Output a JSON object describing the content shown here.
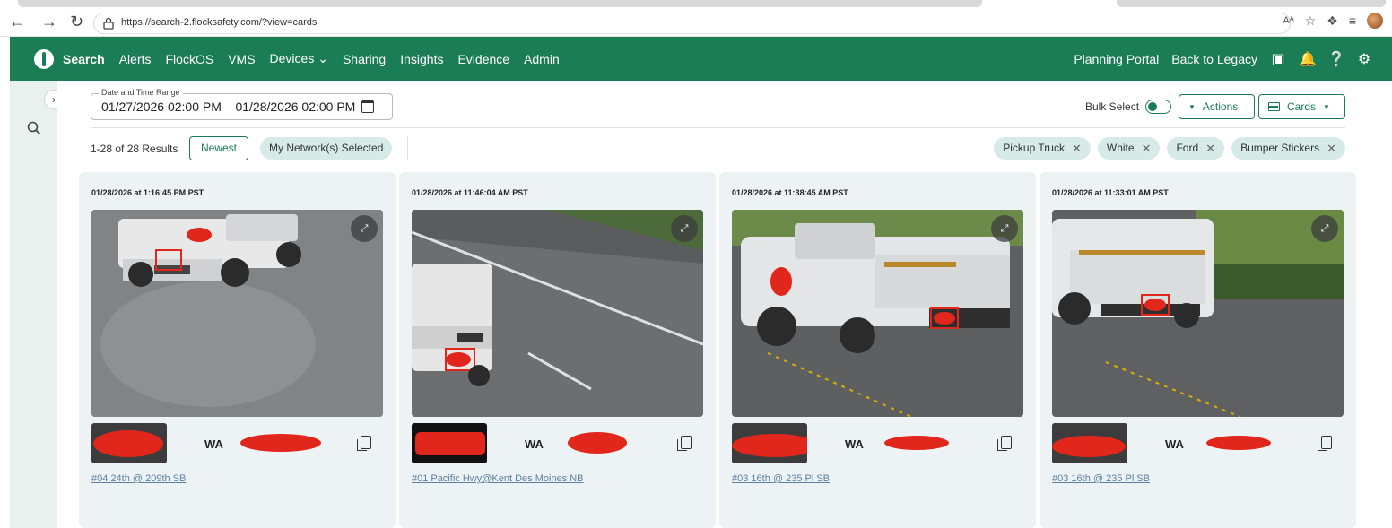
{
  "browser": {
    "url": "https://search-2.flocksafety.com/?view=cards",
    "back_icon": "back-arrow-icon",
    "forward_icon": "forward-arrow-icon",
    "reload_icon": "reload-icon",
    "read_aloud": "Aᴬ"
  },
  "nav": {
    "items": [
      {
        "label": "Search",
        "active": true
      },
      {
        "label": "Alerts"
      },
      {
        "label": "FlockOS"
      },
      {
        "label": "VMS"
      },
      {
        "label": "Devices ⌄"
      },
      {
        "label": "Sharing"
      },
      {
        "label": "Insights"
      },
      {
        "label": "Evidence"
      },
      {
        "label": "Admin"
      }
    ],
    "right_links": [
      "Planning Portal",
      "Back to Legacy"
    ],
    "right_icons": [
      "camera-icon",
      "bell-icon",
      "help-icon",
      "user-settings-icon"
    ]
  },
  "toolbar": {
    "date_label": "Date and Time Range",
    "date_value": "01/27/2026 02:00 PM – 01/28/2026 02:00 PM",
    "bulk_select": "Bulk Select",
    "actions": "Actions",
    "cards": "Cards"
  },
  "results": {
    "count": "1-28 of 28 Results",
    "sort": "Newest",
    "network": "My Network(s) Selected",
    "filters": [
      "Pickup Truck",
      "White",
      "Ford",
      "Bumper Stickers"
    ]
  },
  "cards": [
    {
      "time": "01/28/2026 at 1:16:45 PM PST",
      "state": "WA",
      "camera": "#04 24th @ 209th SB"
    },
    {
      "time": "01/28/2026 at 11:46:04 AM PST",
      "state": "WA",
      "camera": "#01 Pacific Hwy@Kent Des Moines NB"
    },
    {
      "time": "01/28/2026 at 11:38:45 AM PST",
      "state": "WA",
      "camera": "#03 16th @ 235 Pl SB"
    },
    {
      "time": "01/28/2026 at 11:33:01 AM PST",
      "state": "WA",
      "camera": "#03 16th @ 235 Pl SB"
    }
  ],
  "colors": {
    "brand": "#1b7d55",
    "chip_bg": "#d6ebe7",
    "card_bg": "#edf3f5",
    "redaction": "#e1261c"
  }
}
